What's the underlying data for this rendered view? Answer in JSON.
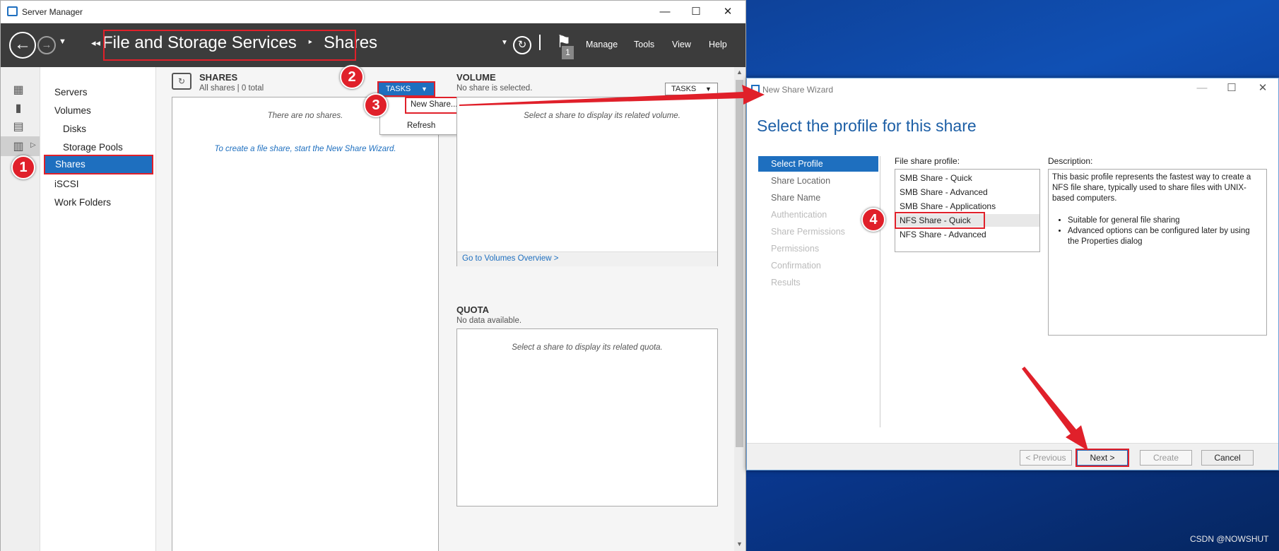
{
  "server_manager": {
    "window_title": "Server Manager",
    "breadcrumb": {
      "part1": "File and Storage Services",
      "separator": "‣",
      "part2": "Shares"
    },
    "menu": {
      "manage": "Manage",
      "tools": "Tools",
      "view": "View",
      "help": "Help"
    },
    "flag_count": "1",
    "sidebar": {
      "items": [
        "Servers",
        "Volumes",
        "Disks",
        "Storage Pools",
        "Shares",
        "iSCSI",
        "Work Folders"
      ],
      "selected": "Shares"
    },
    "shares": {
      "title": "SHARES",
      "subtitle": "All shares | 0 total",
      "tasks_label": "TASKS",
      "empty_text": "There are no shares.",
      "hint": "To create a file share, start the New Share Wizard."
    },
    "tasks_menu": {
      "items": [
        "New Share...",
        "Refresh"
      ]
    },
    "volume": {
      "title": "VOLUME",
      "subtitle": "No share is selected.",
      "tasks_label": "TASKS",
      "empty_text": "Select a share to display its related volume.",
      "link": "Go to Volumes Overview >"
    },
    "quota": {
      "title": "QUOTA",
      "subtitle": "No data available.",
      "empty_text": "Select a share to display its related quota."
    }
  },
  "wizard": {
    "window_title": "New Share Wizard",
    "heading": "Select the profile for this share",
    "steps": [
      {
        "label": "Select Profile",
        "state": "active"
      },
      {
        "label": "Share Location",
        "state": "enabled"
      },
      {
        "label": "Share Name",
        "state": "enabled"
      },
      {
        "label": "Authentication",
        "state": "disabled"
      },
      {
        "label": "Share Permissions",
        "state": "disabled"
      },
      {
        "label": "Permissions",
        "state": "disabled"
      },
      {
        "label": "Confirmation",
        "state": "disabled"
      },
      {
        "label": "Results",
        "state": "disabled"
      }
    ],
    "profile_label": "File share profile:",
    "profiles": [
      "SMB Share - Quick",
      "SMB Share - Advanced",
      "SMB Share - Applications",
      "NFS Share - Quick",
      "NFS Share - Advanced"
    ],
    "selected_profile": "NFS Share - Quick",
    "description_label": "Description:",
    "description": "This basic profile represents the fastest way to create a NFS file share, typically used to share files with UNIX-based computers.",
    "description_bullets": [
      "Suitable for general file sharing",
      "Advanced options can be configured later by using the Properties dialog"
    ],
    "buttons": {
      "previous": "< Previous",
      "next": "Next >",
      "create": "Create",
      "cancel": "Cancel"
    }
  },
  "annotations": {
    "badges": [
      "1",
      "2",
      "3",
      "4"
    ],
    "accent_color": "#e0202a"
  },
  "watermark": "CSDN @NOWSHUT",
  "colors": {
    "header_bg": "#3c3c3c",
    "selection_blue": "#1e6fbf",
    "wizard_heading": "#1d5fa6"
  }
}
